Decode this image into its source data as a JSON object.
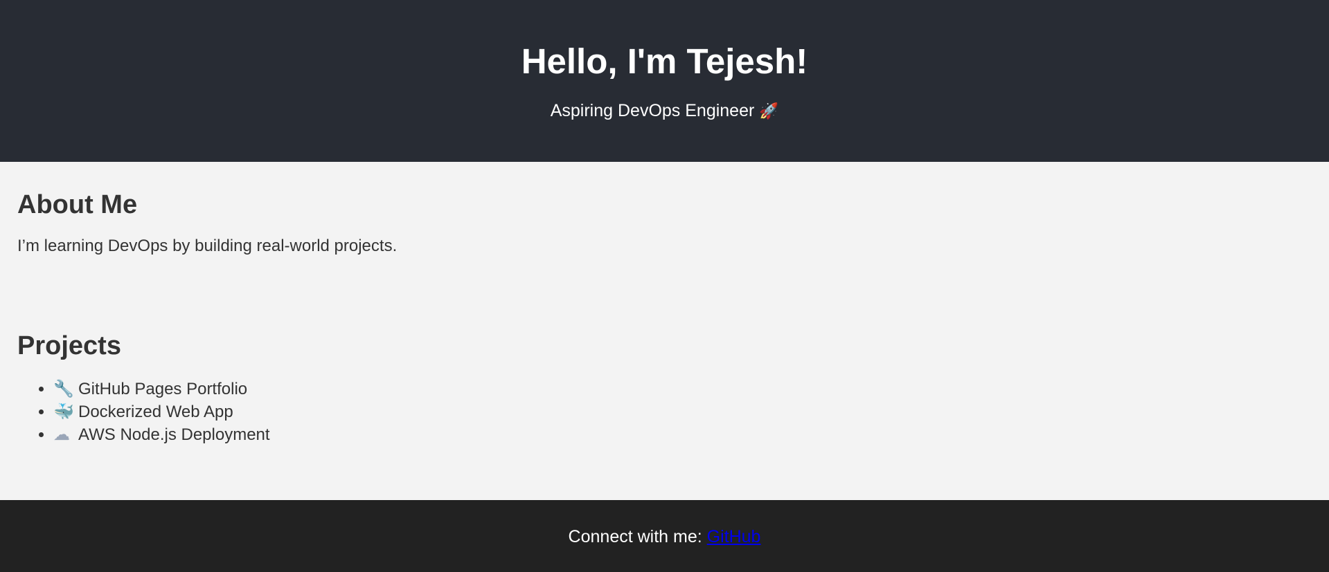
{
  "header": {
    "title": "Hello, I'm Tejesh!",
    "subtitle": "Aspiring DevOps Engineer",
    "subtitle_icon": "rocket-icon",
    "background": "#282c34"
  },
  "about": {
    "heading": "About Me",
    "text": "I’m learning DevOps by building real-world projects."
  },
  "projects": {
    "heading": "Projects",
    "items": [
      {
        "icon": "wrench-icon",
        "label": "GitHub Pages Portfolio"
      },
      {
        "icon": "whale-icon",
        "label": "Dockerized Web App"
      },
      {
        "icon": "cloud-icon",
        "label": "AWS Node.js Deployment"
      }
    ]
  },
  "footer": {
    "text": "Connect with me:",
    "link_label": "GitHub",
    "link_color": "#0000ee",
    "background": "#222222"
  }
}
